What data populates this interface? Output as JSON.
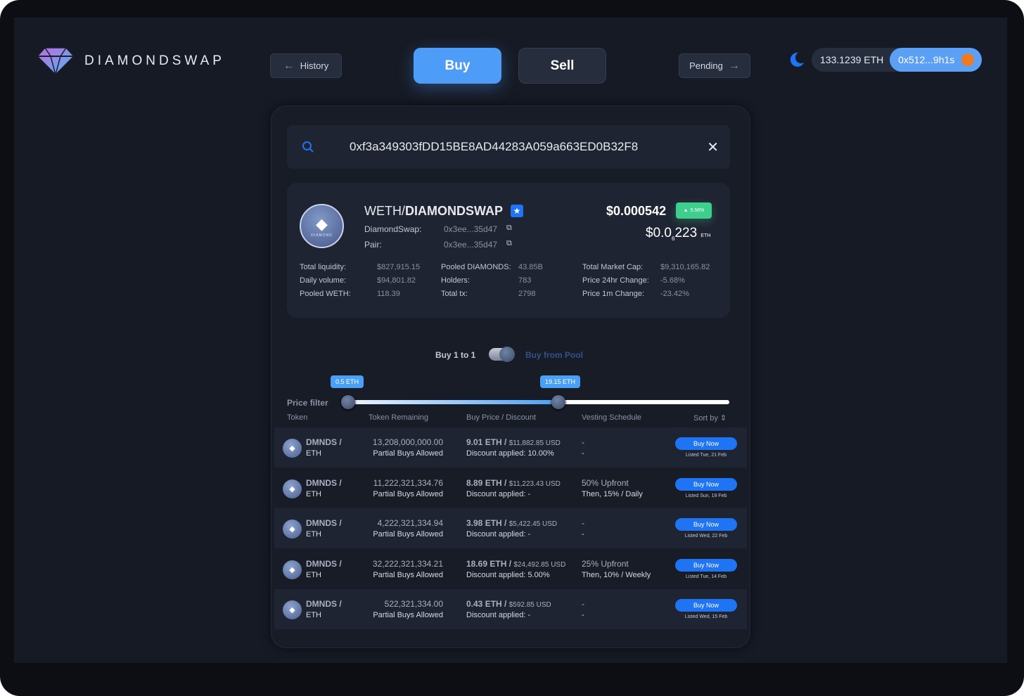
{
  "brand": {
    "name": "DIAMONDSWAP"
  },
  "nav": {
    "history": "History",
    "buy": "Buy",
    "sell": "Sell",
    "pending": "Pending"
  },
  "wallet": {
    "balance": "133.1239 ETH",
    "address": "0x512...9h1s"
  },
  "search": {
    "value": "0xf3a349303fDD15BE8AD44283A059a663ED0B32F8"
  },
  "pair": {
    "logo_text": "DIAMOND",
    "base": "WETH/",
    "quote": "DIAMONDSWAP",
    "diamondswap_label": "DiamondSwap:",
    "diamondswap_addr": "0x3ee...35d47",
    "pair_label": "Pair:",
    "pair_addr": "0x3ee...35d47",
    "price_usd": "$0.000542",
    "change_badge": "5.56%",
    "price_eth_a": "$0.0",
    "price_eth_sub": "6",
    "price_eth_b": "223",
    "price_eth_unit": "ETH"
  },
  "stats": [
    {
      "label": "Total liquidity:",
      "value": "$827,915.15"
    },
    {
      "label": "Daily volume:",
      "value": "$94,801.82"
    },
    {
      "label": "Pooled WETH:",
      "value": "118.39"
    },
    {
      "label": "Pooled DIAMONDS:",
      "value": "43.85B"
    },
    {
      "label": "Holders:",
      "value": "783"
    },
    {
      "label": "Total tx:",
      "value": "2798"
    },
    {
      "label": "Total Market Cap:",
      "value": "$9,310,165.82"
    },
    {
      "label": "Price 24hr Change:",
      "value": "-5.68%"
    },
    {
      "label": "Price 1m Change:",
      "value": "-23.42%"
    }
  ],
  "toggle": {
    "left": "Buy 1 to 1",
    "right": "Buy from Pool"
  },
  "filter": {
    "label": "Price filter",
    "min": "0.5 ETH",
    "max": "19.15 ETH",
    "min_frac": 0,
    "max_frac": 0.55
  },
  "table": {
    "headers": [
      "Token",
      "Token Remaining",
      "Buy Price / Discount",
      "Vesting Schedule",
      "Sort by"
    ],
    "rows": [
      {
        "token": "DMNDS /",
        "base": "ETH",
        "remaining": "13,208,000,000.00",
        "partial": "Partial Buys Allowed",
        "eth": "9.01 ETH /",
        "usd": "$11,882.85 USD",
        "discount": "Discount applied: 10.00%",
        "v1": "-",
        "v2": "-",
        "btn": "Buy Now",
        "listed": "Listed Tue, 21 Feb"
      },
      {
        "token": "DMNDS /",
        "base": "ETH",
        "remaining": "11,222,321,334.76",
        "partial": "Partial Buys Allowed",
        "eth": "8.89 ETH /",
        "usd": "$11,223.43 USD",
        "discount": "Discount applied: -",
        "v1": "50% Upfront",
        "v2": "Then, 15% / Daily",
        "btn": "Buy Now",
        "listed": "Listed Sun, 19 Feb"
      },
      {
        "token": "DMNDS /",
        "base": "ETH",
        "remaining": "4,222,321,334.94",
        "partial": "Partial Buys Allowed",
        "eth": "3.98 ETH /",
        "usd": "$5,422.45 USD",
        "discount": "Discount applied: -",
        "v1": "-",
        "v2": "-",
        "btn": "Buy Now",
        "listed": "Listed Wed, 22 Feb"
      },
      {
        "token": "DMNDS /",
        "base": "ETH",
        "remaining": "32,222,321,334.21",
        "partial": "Partial Buys Allowed",
        "eth": "18.69 ETH /",
        "usd": "$24,492.85 USD",
        "discount": "Discount applied: 5.00%",
        "v1": "25% Upfront",
        "v2": "Then, 10% / Weekly",
        "btn": "Buy Now",
        "listed": "Listed Tue, 14 Feb"
      },
      {
        "token": "DMNDS /",
        "base": "ETH",
        "remaining": "522,321,334.00",
        "partial": "Partial Buys Allowed",
        "eth": "0.43 ETH /",
        "usd": "$592.85 USD",
        "discount": "Discount applied: -",
        "v1": "-",
        "v2": "-",
        "btn": "Buy Now",
        "listed": "Listed Wed, 15 Feb"
      }
    ]
  }
}
